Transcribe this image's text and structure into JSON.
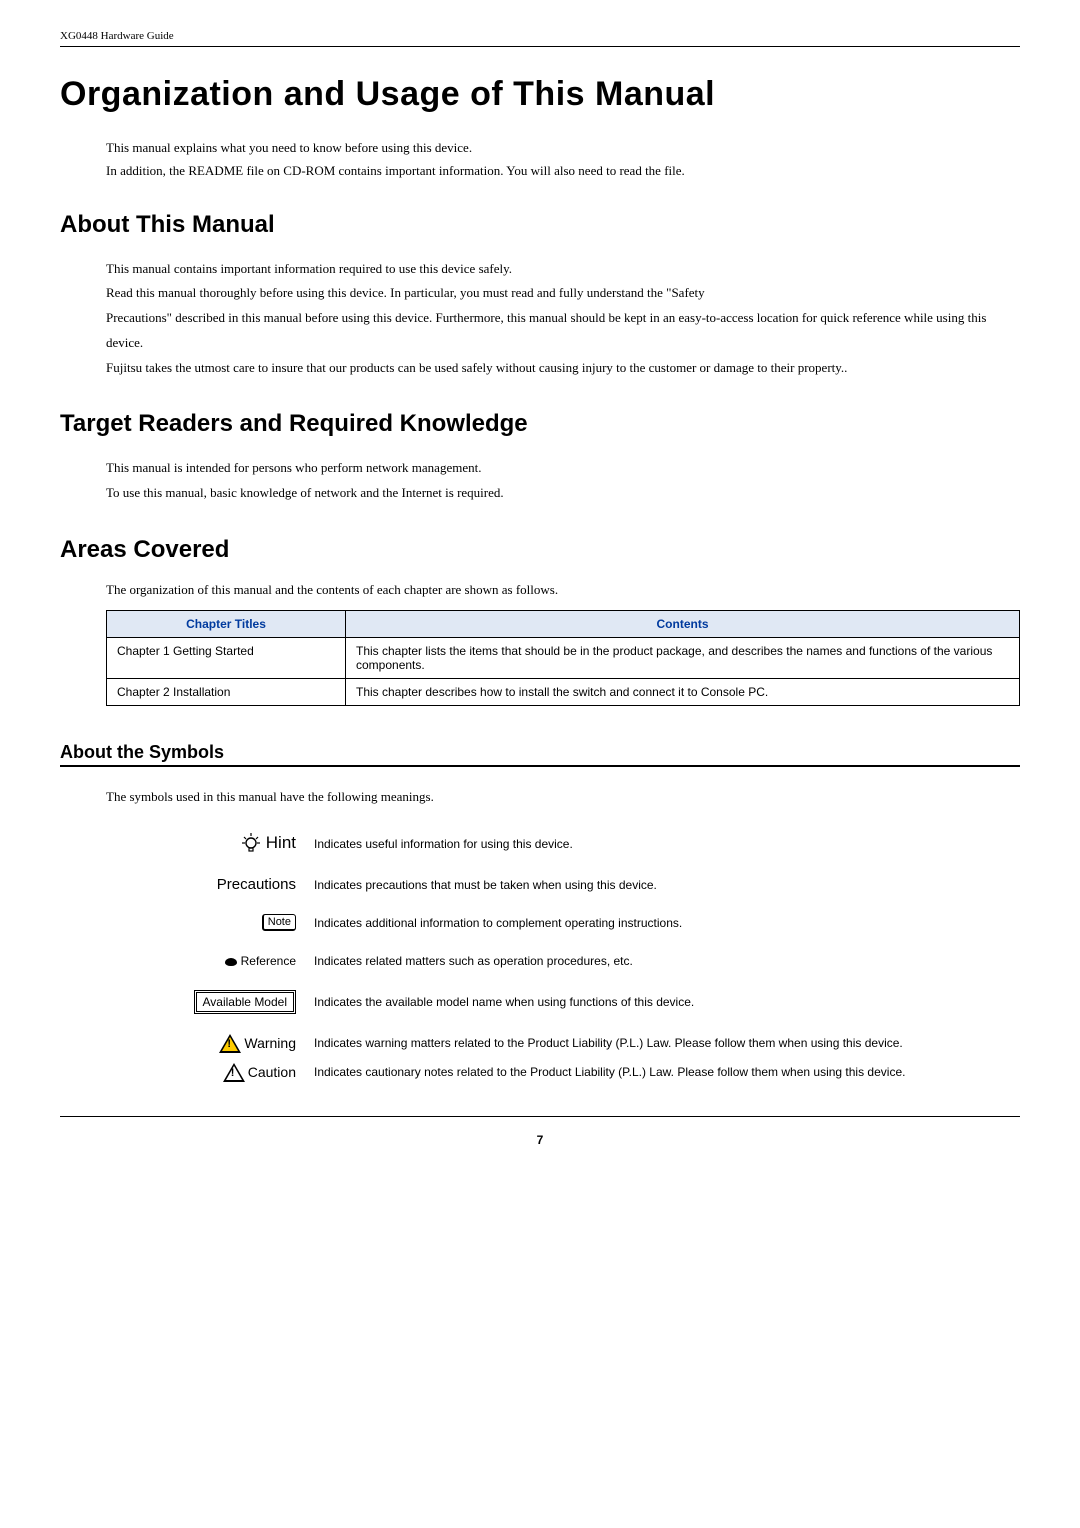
{
  "header": {
    "doc_title": "XG0448 Hardware Guide"
  },
  "title": "Organization and Usage of This Manual",
  "intro": {
    "p1": "This manual explains what you need to know before using this device.",
    "p2": "In addition, the README file on CD-ROM contains important information. You will also need to read the file."
  },
  "sections": {
    "about_manual": {
      "heading": "About This Manual",
      "p1": "This manual contains important information required to use this device safely.",
      "p2": "Read this manual thoroughly before using this device. In particular, you must read and fully understand the \"Safety",
      "p3": "Precautions\" described in this manual before using this device. Furthermore, this manual should be kept in an easy-to-access location for quick reference while using this device.",
      "p4": "Fujitsu takes the utmost care to insure that our products can be used safely without causing injury to the customer or damage to their property.."
    },
    "target_readers": {
      "heading": "Target Readers and Required Knowledge",
      "p1": "This manual is intended for persons who perform network management.",
      "p2": "To use this manual, basic knowledge of network and the Internet is required."
    },
    "areas_covered": {
      "heading": "Areas Covered",
      "intro": "The organization of this manual and the contents of each chapter are shown as follows.",
      "th1": "Chapter Titles",
      "th2": "Contents",
      "rows": [
        {
          "title": "Chapter 1 Getting Started",
          "content": "This chapter lists the items that should be in the product package, and describes the names and functions of the various components."
        },
        {
          "title": "Chapter 2 Installation",
          "content": "This chapter describes how to install the switch and connect it to Console PC."
        }
      ]
    },
    "about_symbols": {
      "heading": "About the Symbols",
      "intro": "The symbols used in this manual have the following meanings.",
      "items": {
        "hint": {
          "label": "Hint",
          "desc": "Indicates useful information for using this device."
        },
        "precautions": {
          "label": "Precautions",
          "desc": "Indicates precautions that must be taken when using this device."
        },
        "note": {
          "label": "Note",
          "desc": "Indicates additional information to complement operating instructions."
        },
        "reference": {
          "label": "Reference",
          "desc": "Indicates related matters such as operation procedures, etc."
        },
        "available_model": {
          "label": "Available Model",
          "desc": "Indicates the available model name when using functions of this device."
        },
        "warning": {
          "label": "Warning",
          "desc": "Indicates warning matters related to the Product Liability (P.L.) Law. Please follow them when using this device."
        },
        "caution": {
          "label": "Caution",
          "desc": "Indicates cautionary notes related to the Product Liability (P.L.) Law. Please follow them when using this device."
        }
      }
    }
  },
  "footer": {
    "page_number": "7"
  }
}
